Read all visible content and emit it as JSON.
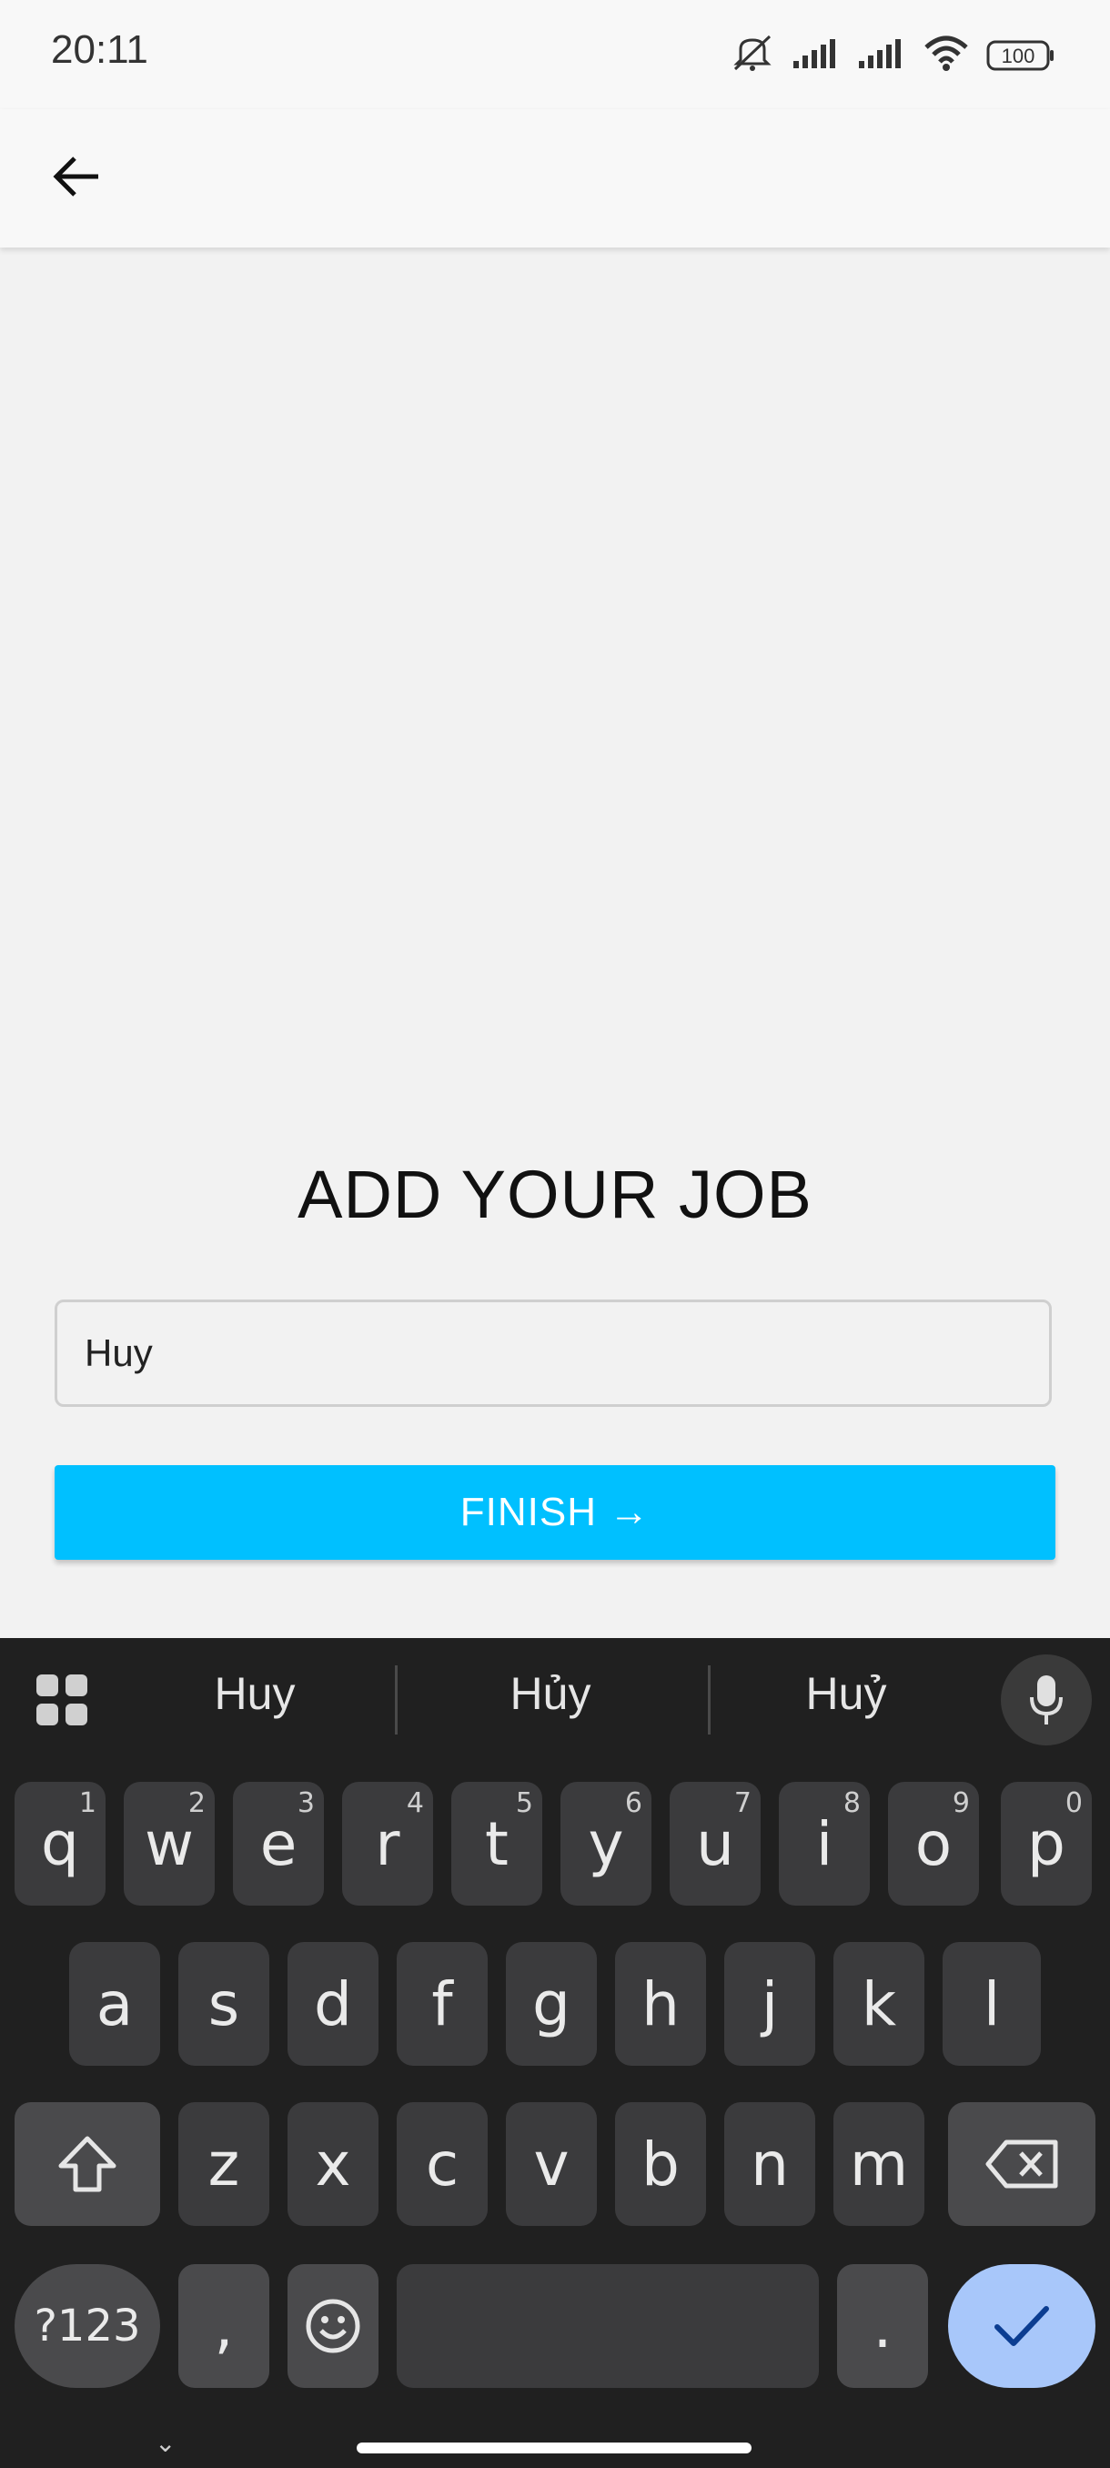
{
  "status": {
    "time": "20:11",
    "battery": "100",
    "icons": [
      "mute-icon",
      "signal-icon",
      "signal-icon",
      "wifi-icon",
      "battery-icon"
    ]
  },
  "appbar": {
    "back_icon": "back-arrow-icon"
  },
  "form": {
    "title": "ADD YOUR JOB",
    "input_value": "Huy",
    "finish_label": "FINISH →"
  },
  "keyboard": {
    "suggestions": [
      "Huy",
      "Hủy",
      "Huỷ"
    ],
    "row1": [
      {
        "k": "q",
        "h": "1"
      },
      {
        "k": "w",
        "h": "2"
      },
      {
        "k": "e",
        "h": "3"
      },
      {
        "k": "r",
        "h": "4"
      },
      {
        "k": "t",
        "h": "5"
      },
      {
        "k": "y",
        "h": "6"
      },
      {
        "k": "u",
        "h": "7"
      },
      {
        "k": "i",
        "h": "8"
      },
      {
        "k": "o",
        "h": "9"
      },
      {
        "k": "p",
        "h": "0"
      }
    ],
    "row2": [
      "a",
      "s",
      "d",
      "f",
      "g",
      "h",
      "j",
      "k",
      "l"
    ],
    "row3": [
      "z",
      "x",
      "c",
      "v",
      "b",
      "n",
      "m"
    ],
    "symbols_label": "?123",
    "comma_label": ",",
    "period_label": ".",
    "accent_color": "#a8c7fa"
  }
}
